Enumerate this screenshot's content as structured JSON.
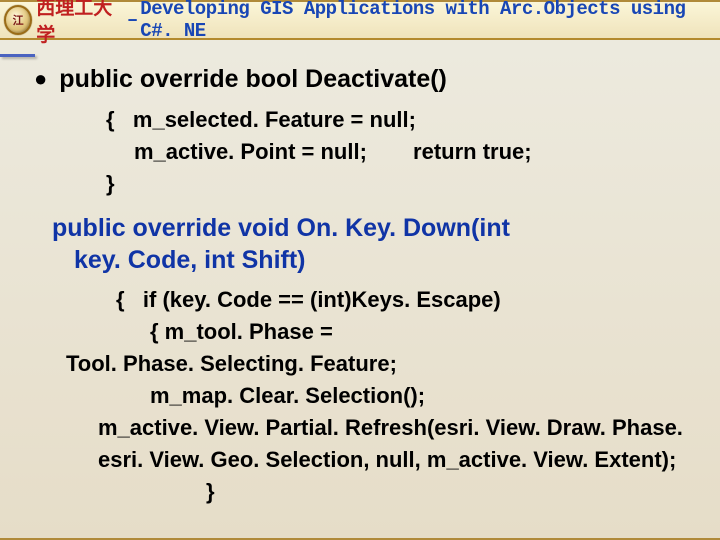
{
  "header": {
    "logo_inner": "江",
    "university": "西理工大学",
    "dash": " – ",
    "course": "Developing GIS Applications with Arc.Objects using C#. NE"
  },
  "content": {
    "bullet": "●",
    "sig_deactivate": "public override bool Deactivate()",
    "deact_l1": "{   m_selected. Feature = null;",
    "deact_l2_a": "m_active. Point = null;",
    "deact_l2_b": "return true;",
    "deact_close": "}",
    "sig_onkeydown_l1": "public override void On. Key. Down(int",
    "sig_onkeydown_l2": "key. Code, int Shift)",
    "kd_l1": "{   if (key. Code == (int)Keys. Escape)",
    "kd_l2": "{ m_tool. Phase =",
    "kd_l3": "Tool. Phase. Selecting. Feature;",
    "kd_l4": "m_map. Clear. Selection();",
    "kd_l5": "m_active. View. Partial. Refresh(esri. View. Draw. Phase.",
    "kd_l6": "esri. View. Geo. Selection, null, m_active. View. Extent);",
    "kd_close": "}"
  }
}
